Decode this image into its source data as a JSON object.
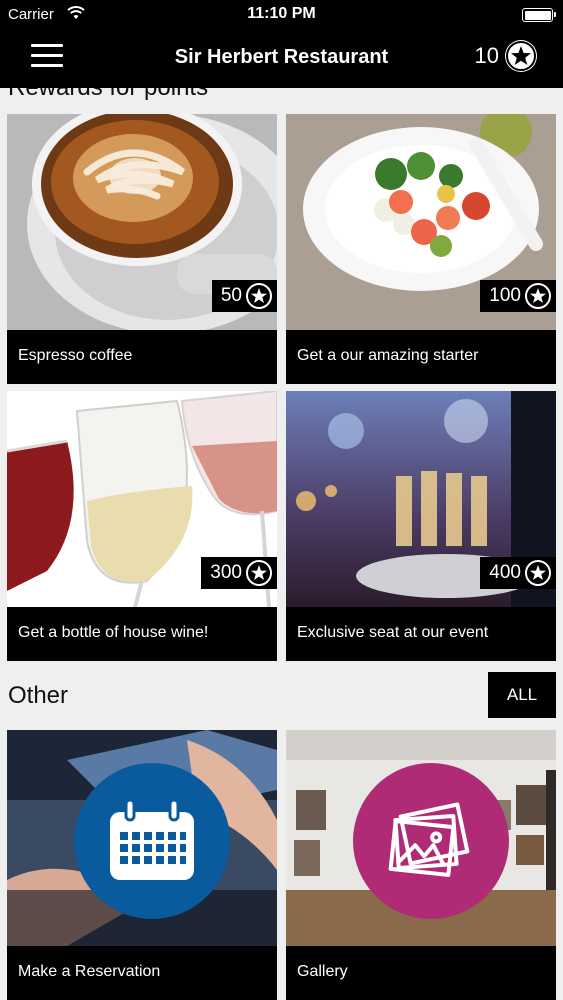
{
  "status_bar": {
    "carrier": "Carrier",
    "time": "11:10 PM"
  },
  "nav": {
    "title": "Sir Herbert Restaurant",
    "points": "10"
  },
  "rewards_section": {
    "title": "Rewards for points"
  },
  "rewards": [
    {
      "label": "Espresso coffee",
      "points": "50",
      "image": "espresso-latte-art"
    },
    {
      "label": "Get a our amazing starter",
      "points": "100",
      "image": "shrimp-starter-plate"
    },
    {
      "label": "Get a bottle of house wine!",
      "points": "300",
      "image": "wine-glasses-toast"
    },
    {
      "label": "Exclusive seat at our event",
      "points": "400",
      "image": "champagne-event"
    }
  ],
  "other_section": {
    "title": "Other",
    "all_label": "ALL"
  },
  "other": [
    {
      "label": "Make a Reservation",
      "icon": "calendar-icon",
      "color": "#0a5a9e"
    },
    {
      "label": "Gallery",
      "icon": "photos-icon",
      "color": "#b02b76"
    }
  ]
}
